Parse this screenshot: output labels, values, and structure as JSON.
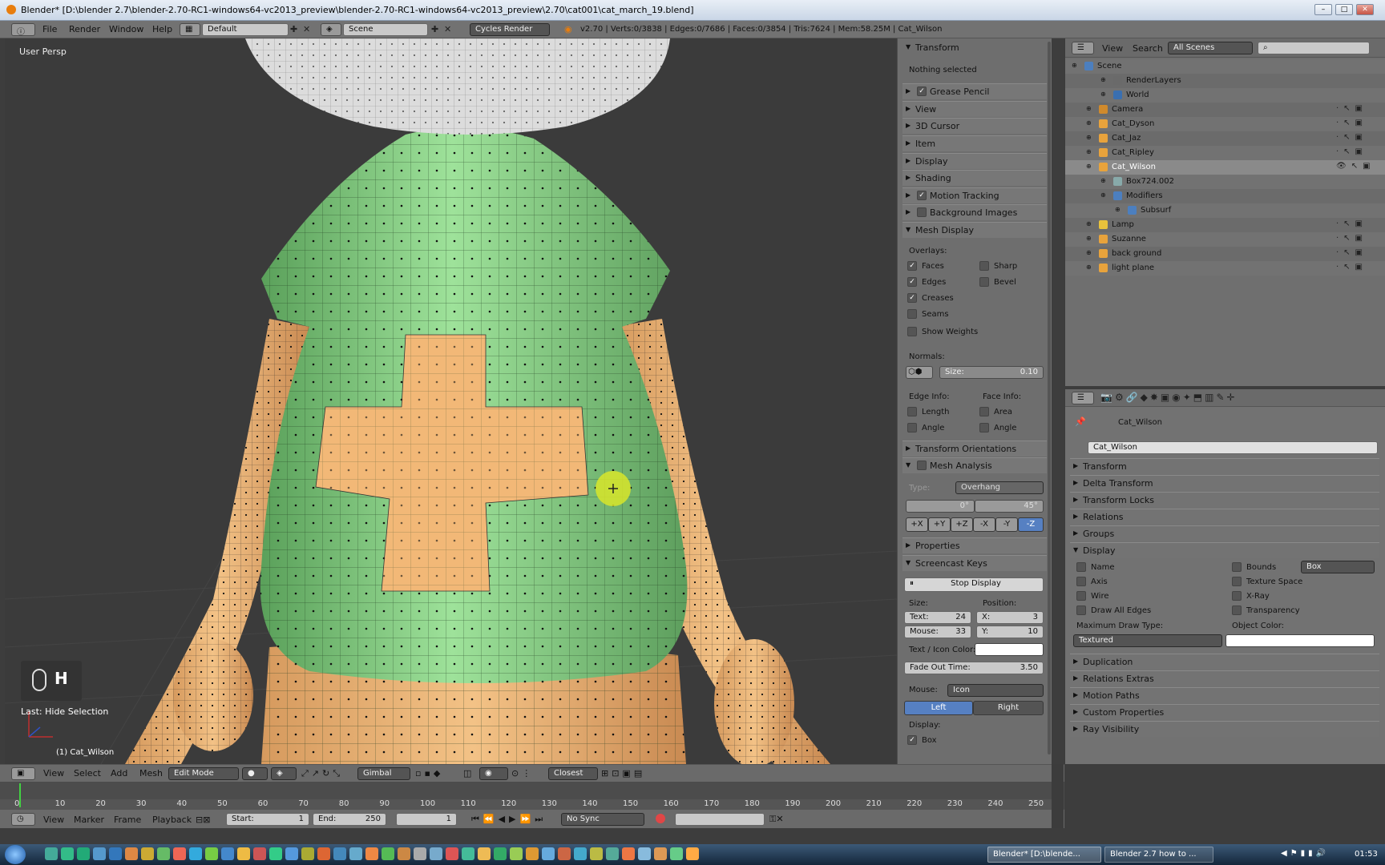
{
  "window": {
    "title": "Blender* [D:\\blender 2.7\\blender-2.70-RC1-windows64-vc2013_preview\\blender-2.70-RC1-windows64-vc2013_preview\\2.70\\cat001\\cat_march_19.blend]",
    "min": "–",
    "max": "□",
    "close": "✕"
  },
  "topbar": {
    "menus": [
      "File",
      "Render",
      "Window",
      "Help"
    ],
    "layout": "Default",
    "scene": "Scene",
    "engine": "Cycles Render",
    "stats": "v2.70 | Verts:0/3838 | Edges:0/7686 | Faces:0/3854 | Tris:7624 | Mem:58.25M | Cat_Wilson"
  },
  "viewport": {
    "view_label": "User Persp",
    "key_display": "H",
    "last_op": "Last: Hide Selection",
    "object_label": "(1) Cat_Wilson"
  },
  "npanel": {
    "transform": "Transform",
    "nothing_selected": "Nothing selected",
    "collapsed": [
      "Grease Pencil",
      "View",
      "3D Cursor",
      "Item",
      "Display",
      "Shading",
      "Motion Tracking",
      "Background Images"
    ],
    "mesh_display": "Mesh Display",
    "overlays": "Overlays:",
    "faces": "Faces",
    "sharp": "Sharp",
    "edges": "Edges",
    "bevel": "Bevel",
    "creases": "Creases",
    "seams": "Seams",
    "show_weights": "Show Weights",
    "normals": "Normals:",
    "size_label": "Size:",
    "size_value": "0.10",
    "edge_info": "Edge Info:",
    "face_info": "Face Info:",
    "length": "Length",
    "area": "Area",
    "angle1": "Angle",
    "angle2": "Angle",
    "transform_orientations": "Transform Orientations",
    "mesh_analysis": "Mesh Analysis",
    "type_label": "Type:",
    "type_value": "Overhang",
    "angle_min": "0°",
    "angle_max": "45°",
    "axes": [
      "+X",
      "+Y",
      "+Z",
      "-X",
      "-Y",
      "-Z"
    ],
    "properties": "Properties",
    "screencast": "Screencast Keys",
    "stop_display": "Stop Display",
    "size_hdr": "Size:",
    "position_hdr": "Position:",
    "text_label": "Text:",
    "text_val": "24",
    "x_label": "X:",
    "x_val": "3",
    "mouse_label": "Mouse:",
    "mouse_val": "33",
    "y_label": "Y:",
    "y_val": "10",
    "icon_color": "Text / Icon Color:",
    "fade_label": "Fade Out Time:",
    "fade_val": "3.50",
    "mouse_mode_label": "Mouse:",
    "mouse_mode_val": "Icon",
    "left": "Left",
    "right": "Right",
    "display_label": "Display:",
    "box": "Box"
  },
  "outliner": {
    "view": "View",
    "search": "Search",
    "scope": "All Scenes",
    "rows": [
      {
        "label": "Scene",
        "indent": 0
      },
      {
        "label": "RenderLayers",
        "indent": 2
      },
      {
        "label": "World",
        "indent": 2
      },
      {
        "label": "Camera",
        "indent": 1
      },
      {
        "label": "Cat_Dyson",
        "indent": 1
      },
      {
        "label": "Cat_Jaz",
        "indent": 1
      },
      {
        "label": "Cat_Ripley",
        "indent": 1
      },
      {
        "label": "Cat_Wilson",
        "indent": 1
      },
      {
        "label": "Box724.002",
        "indent": 2
      },
      {
        "label": "Modifiers",
        "indent": 2
      },
      {
        "label": "Subsurf",
        "indent": 3
      },
      {
        "label": "Lamp",
        "indent": 1
      },
      {
        "label": "Suzanne",
        "indent": 1
      },
      {
        "label": "back ground",
        "indent": 1
      },
      {
        "label": "light plane",
        "indent": 1
      }
    ]
  },
  "properties": {
    "context": "Cat_Wilson",
    "object_name": "Cat_Wilson",
    "sections_top": [
      "Transform",
      "Delta Transform",
      "Transform Locks",
      "Relations",
      "Groups"
    ],
    "display": "Display",
    "name": "Name",
    "bounds": "Bounds",
    "bounds_type": "Box",
    "axis": "Axis",
    "texture_space": "Texture Space",
    "wire": "Wire",
    "xray": "X-Ray",
    "draw_all_edges": "Draw All Edges",
    "transparency": "Transparency",
    "max_draw_type": "Maximum Draw Type:",
    "object_color": "Object Color:",
    "textured": "Textured",
    "sections_bottom": [
      "Duplication",
      "Relations Extras",
      "Motion Paths",
      "Custom Properties",
      "Ray Visibility"
    ]
  },
  "viewheader": {
    "menus": [
      "View",
      "Select",
      "Add",
      "Mesh"
    ],
    "mode": "Edit Mode",
    "orientation": "Gimbal",
    "snap": "Closest"
  },
  "timeline": {
    "ticks": [
      "0",
      "10",
      "20",
      "30",
      "40",
      "50",
      "60",
      "70",
      "80",
      "90",
      "100",
      "110",
      "120",
      "130",
      "140",
      "150",
      "160",
      "170",
      "180",
      "190",
      "200",
      "210",
      "220",
      "230",
      "240",
      "250"
    ],
    "menus": [
      "View",
      "Marker",
      "Frame",
      "Playback"
    ],
    "start_label": "Start:",
    "start_val": "1",
    "end_label": "End:",
    "end_val": "250",
    "current": "1",
    "sync": "No Sync"
  },
  "taskbar": {
    "task1": "Blender* [D:\\blende...",
    "task2": "Blender 2.7 how to ...",
    "time": "01:53"
  }
}
